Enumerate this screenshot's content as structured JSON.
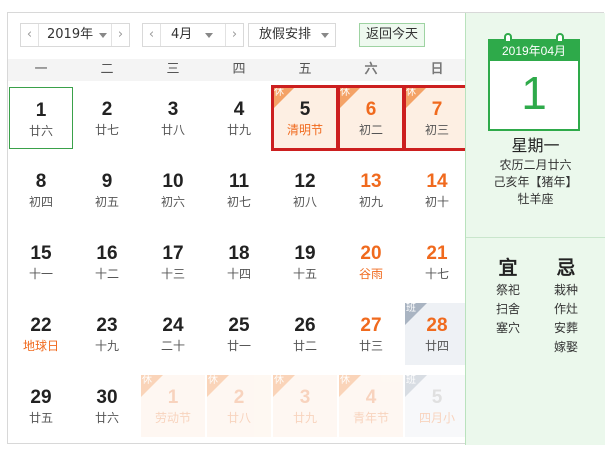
{
  "toolbar": {
    "prev_arrow": "‹",
    "next_arrow": "›",
    "year_value": "2019年",
    "month_value": "4月",
    "holiday_value": "放假安排",
    "today_label": "返回今天"
  },
  "weekdays": [
    "一",
    "二",
    "三",
    "四",
    "五",
    "六",
    "日"
  ],
  "rows": [
    [
      {
        "d": "1",
        "l": "廿六",
        "selected": true
      },
      {
        "d": "2",
        "l": "廿七"
      },
      {
        "d": "3",
        "l": "廿八"
      },
      {
        "d": "4",
        "l": "廿九"
      },
      {
        "d": "5",
        "l": "清明节",
        "holiday": true,
        "festival": true,
        "badge": "休"
      },
      {
        "d": "6",
        "l": "初二",
        "holiday": true,
        "weekend": true,
        "badge": "休"
      },
      {
        "d": "7",
        "l": "初三",
        "holiday": true,
        "weekend": true,
        "badge": "休"
      }
    ],
    [
      {
        "d": "8",
        "l": "初四"
      },
      {
        "d": "9",
        "l": "初五"
      },
      {
        "d": "10",
        "l": "初六"
      },
      {
        "d": "11",
        "l": "初七"
      },
      {
        "d": "12",
        "l": "初八"
      },
      {
        "d": "13",
        "l": "初九",
        "weekend": true
      },
      {
        "d": "14",
        "l": "初十",
        "weekend": true
      }
    ],
    [
      {
        "d": "15",
        "l": "十一"
      },
      {
        "d": "16",
        "l": "十二"
      },
      {
        "d": "17",
        "l": "十三"
      },
      {
        "d": "18",
        "l": "十四"
      },
      {
        "d": "19",
        "l": "十五"
      },
      {
        "d": "20",
        "l": "谷雨",
        "weekend": true,
        "festival": true
      },
      {
        "d": "21",
        "l": "十七",
        "weekend": true
      }
    ],
    [
      {
        "d": "22",
        "l": "地球日",
        "festival": true
      },
      {
        "d": "23",
        "l": "十九"
      },
      {
        "d": "24",
        "l": "二十"
      },
      {
        "d": "25",
        "l": "廿一"
      },
      {
        "d": "26",
        "l": "廿二"
      },
      {
        "d": "27",
        "l": "廿三",
        "weekend": true
      },
      {
        "d": "28",
        "l": "廿四",
        "weekend": true,
        "workday": true,
        "badge": "班"
      }
    ],
    [
      {
        "d": "29",
        "l": "廿五"
      },
      {
        "d": "30",
        "l": "廿六"
      },
      {
        "d": "1",
        "l": "劳动节",
        "outer": true,
        "holiday": true,
        "festival": true,
        "badge": "休"
      },
      {
        "d": "2",
        "l": "廿八",
        "outer": true,
        "holiday": true,
        "badge": "休"
      },
      {
        "d": "3",
        "l": "廿九",
        "outer": true,
        "holiday": true,
        "badge": "休"
      },
      {
        "d": "4",
        "l": "青年节",
        "outer": true,
        "holiday": true,
        "festival": true,
        "badge": "休"
      },
      {
        "d": "5",
        "l": "四月小",
        "outer": true,
        "workday": true,
        "badge": "班"
      }
    ]
  ],
  "side": {
    "icon_header": "2019年04月",
    "icon_day": "1",
    "weekday": "星期一",
    "lunar_date": "农历二月廿六",
    "ganzhi": "己亥年【猪年】",
    "constellation": "牡羊座",
    "yi_title": "宜",
    "yi_items": [
      "祭祀",
      "扫舍",
      "塞穴"
    ],
    "ji_title": "忌",
    "ji_items": [
      "栽种",
      "作灶",
      "安葬",
      "嫁娶"
    ]
  },
  "colors": {
    "accent_green": "#2eaa4a",
    "weekend_orange": "#f06a1e",
    "highlight_red": "#cc1f1f"
  }
}
